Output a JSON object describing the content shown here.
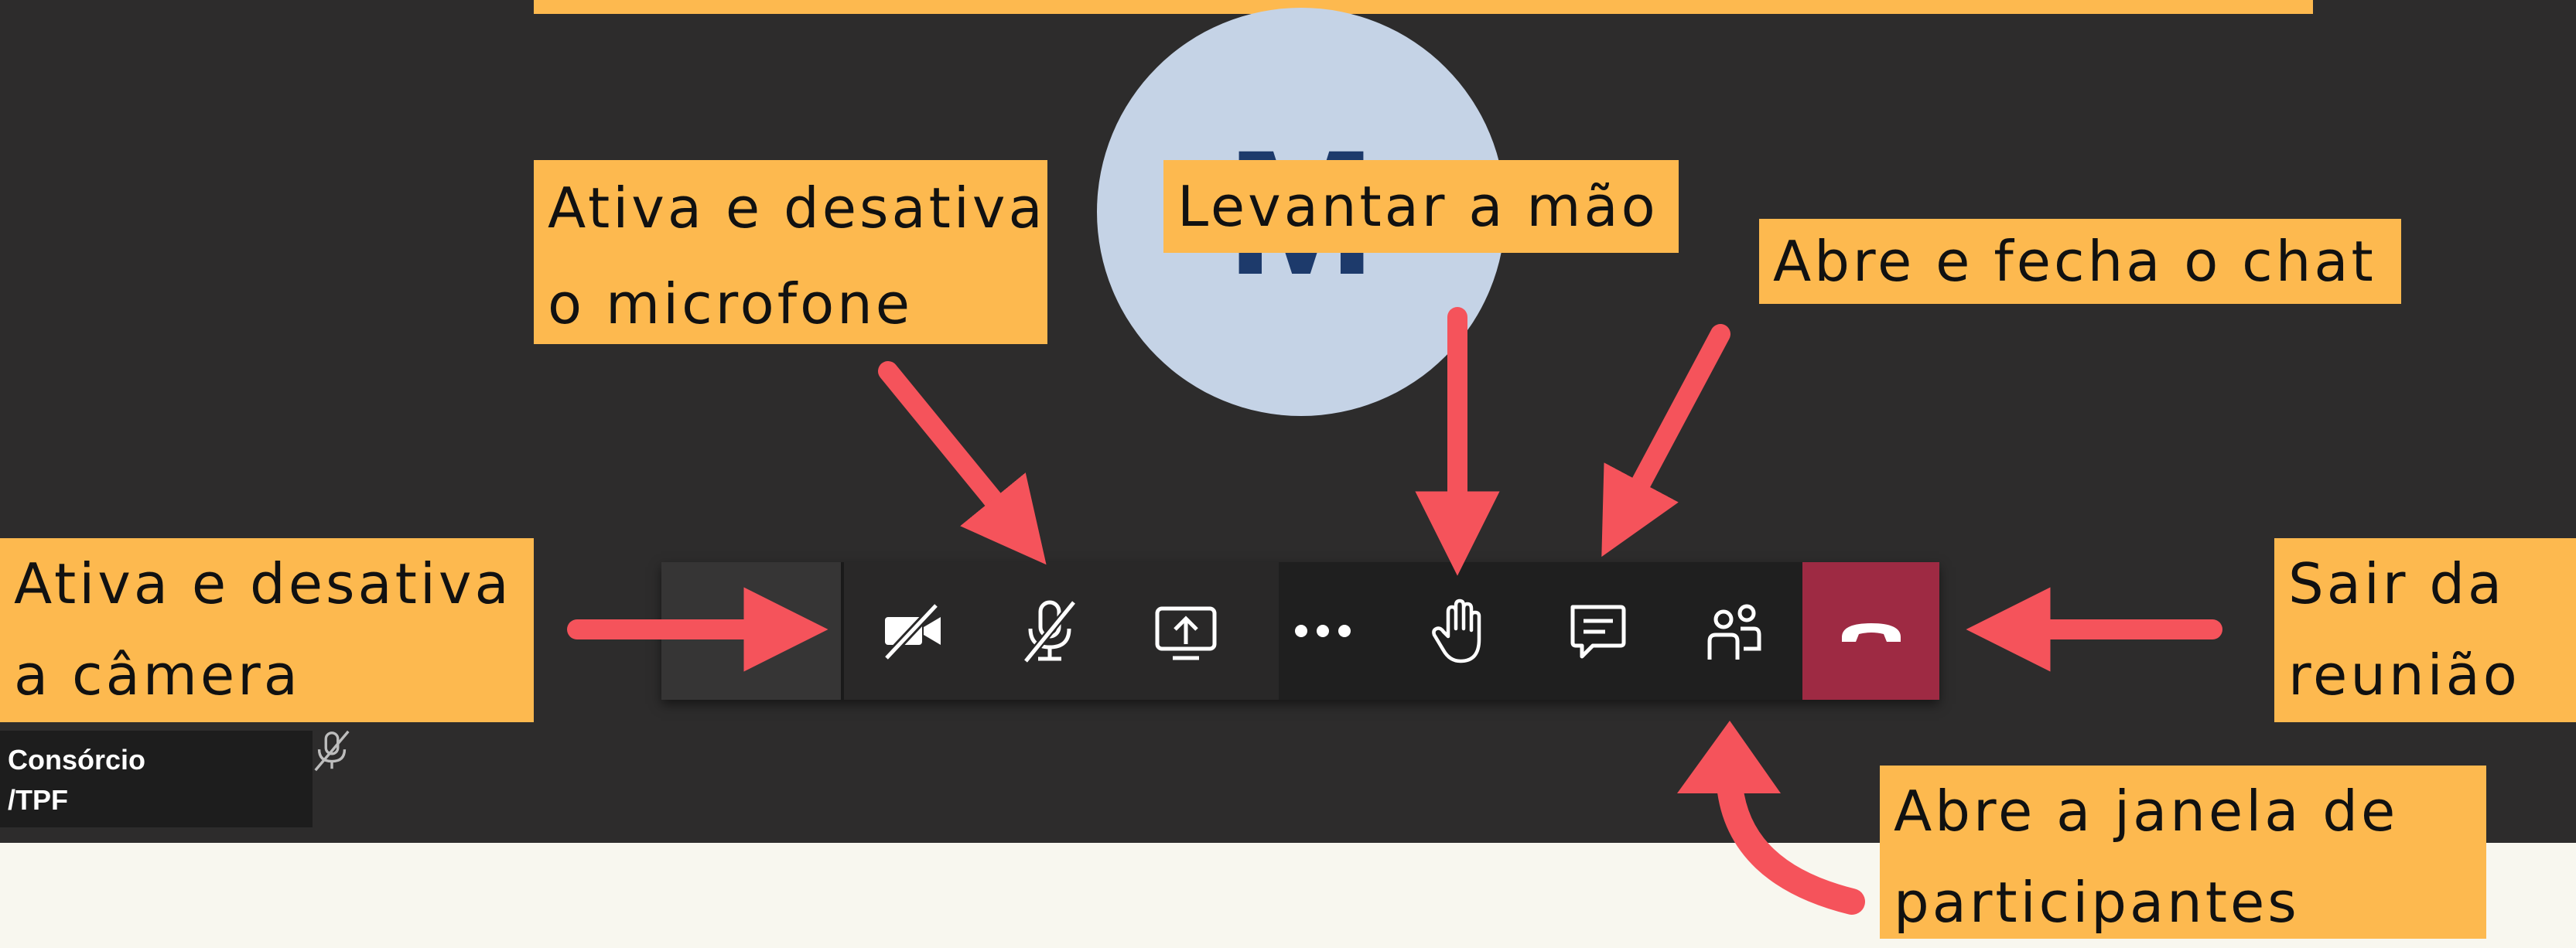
{
  "avatar": {
    "initial": "M"
  },
  "toolbar": {
    "buttons": [
      {
        "name": "camera-toggle-button",
        "icon": "video-off-icon"
      },
      {
        "name": "microphone-toggle-button",
        "icon": "mic-off-icon"
      },
      {
        "name": "share-screen-button",
        "icon": "share-screen-icon"
      },
      {
        "name": "more-options-button",
        "icon": "more-horizontal-icon"
      },
      {
        "name": "raise-hand-button",
        "icon": "hand-icon"
      },
      {
        "name": "chat-button",
        "icon": "chat-icon"
      },
      {
        "name": "participants-button",
        "icon": "people-icon"
      },
      {
        "name": "leave-meeting-button",
        "icon": "hang-up-icon"
      }
    ]
  },
  "labels": {
    "microphone": [
      "Ativa e desativa",
      "o microfone"
    ],
    "raise_hand": "Levantar a mão",
    "chat": "Abre e fecha o chat",
    "camera": [
      "Ativa e desativa",
      "a câmera"
    ],
    "leave": [
      "Sair da",
      "reunião"
    ],
    "participants": [
      "Abre a janela de",
      "participantes"
    ]
  },
  "participant_tile": {
    "line1": "Consórcio",
    "line2": "/TPF"
  },
  "colors": {
    "background": "#2d2c2c",
    "label_bg": "#fdb94f",
    "arrow": "#f5535b",
    "hangup": "#9e2a43",
    "avatar": "#c5d3e6",
    "page_bottom": "#f8f7ef"
  }
}
